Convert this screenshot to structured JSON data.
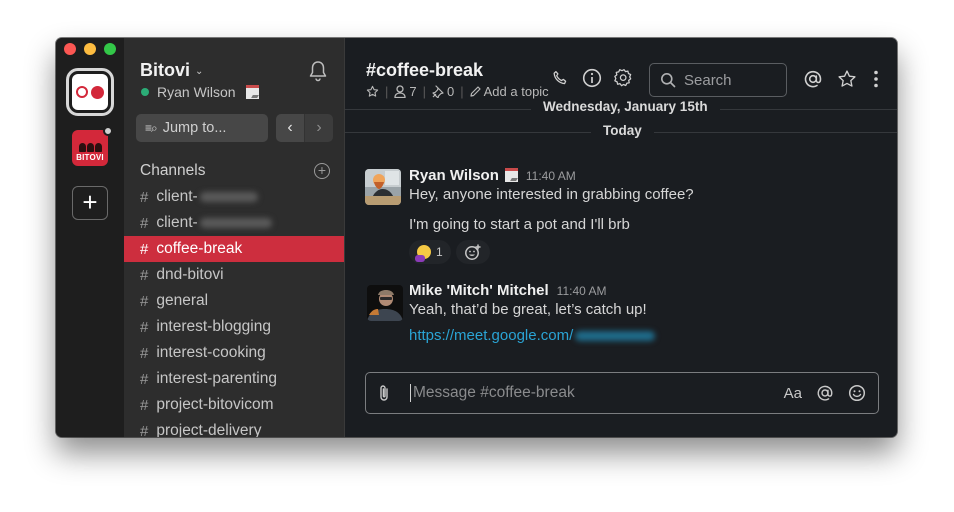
{
  "window": {
    "traffic_lights": [
      "close",
      "minimize",
      "maximize"
    ]
  },
  "workspaces": {
    "active_icon": "bitovi-dots-logo",
    "second_label": "BITOVI",
    "add_label": "+"
  },
  "sidebar": {
    "workspace_name": "Bitovi",
    "workspace_chevron": "⌄",
    "user_name": "Ryan Wilson",
    "user_status_emoji": "calendar",
    "presence": "active",
    "jump_to_label": "Jump to...",
    "nav_back": "‹",
    "nav_forward": "›",
    "channels_header": "Channels",
    "add_channel": "+",
    "channels": [
      {
        "name": "client-",
        "redacted": true,
        "active": false
      },
      {
        "name": "client-",
        "redacted": true,
        "active": false
      },
      {
        "name": "coffee-break",
        "redacted": false,
        "active": true
      },
      {
        "name": "dnd-bitovi",
        "redacted": false,
        "active": false
      },
      {
        "name": "general",
        "redacted": false,
        "active": false
      },
      {
        "name": "interest-blogging",
        "redacted": false,
        "active": false
      },
      {
        "name": "interest-cooking",
        "redacted": false,
        "active": false
      },
      {
        "name": "interest-parenting",
        "redacted": false,
        "active": false
      },
      {
        "name": "project-bitovicom",
        "redacted": false,
        "active": false
      },
      {
        "name": "project-delivery",
        "redacted": false,
        "active": false
      }
    ]
  },
  "header": {
    "channel_title": "#coffee-break",
    "member_count": "7",
    "pinned_count": "0",
    "add_topic": "Add a topic",
    "search_placeholder": "Search"
  },
  "dividers": {
    "date": "Wednesday, January 15th",
    "today": "Today"
  },
  "messages": [
    {
      "author": "Ryan Wilson",
      "status_emoji": "calendar",
      "time": "11:40 AM",
      "lines": [
        "Hey, anyone interested in grabbing coffee?",
        "I'm going to start a pot and I'll brb"
      ],
      "reactions": [
        {
          "emoji": "facepalm",
          "count": "1"
        }
      ]
    },
    {
      "author": "Mike 'Mitch' Mitchel",
      "time": "11:40 AM",
      "lines": [
        "Yeah, that’d be great, let’s catch up!"
      ],
      "link": "https://meet.google.com/",
      "link_redacted": true
    }
  ],
  "composer": {
    "placeholder": "Message #coffee-break",
    "format_label": "Aa"
  },
  "colors": {
    "accent_red": "#cd2e3e",
    "presence_green": "#2bac76",
    "link_blue": "#2aa4d5",
    "sidebar_bg": "#2d2d2d",
    "main_bg": "#1a1d21"
  }
}
